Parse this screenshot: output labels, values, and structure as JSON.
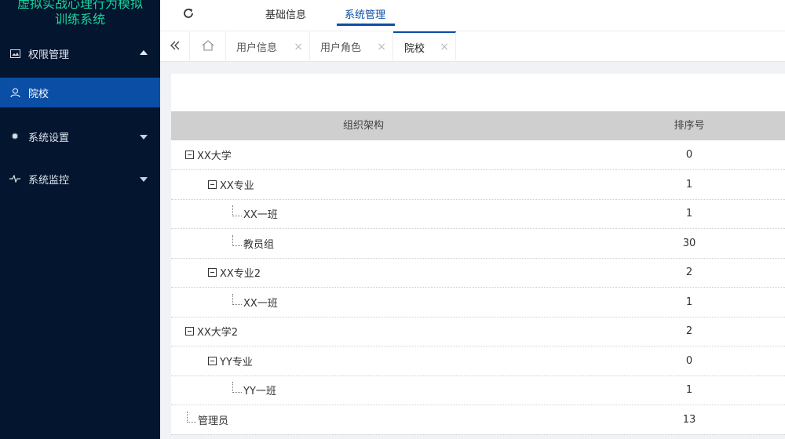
{
  "app": {
    "title_line1": "虚拟实战心理行为模拟",
    "title_line2": "训练系统"
  },
  "sidebar": {
    "items": [
      {
        "label": "权限管理",
        "icon": "image-icon",
        "expanded": true
      },
      {
        "label": "院校",
        "icon": "user-icon",
        "active": true
      },
      {
        "label": "系统设置",
        "icon": "gear-icon"
      },
      {
        "label": "系统监控",
        "icon": "pulse-icon"
      }
    ]
  },
  "topnav": {
    "tabs": [
      "基础信息",
      "系统管理"
    ],
    "active": "系统管理"
  },
  "tabs": {
    "items": [
      "用户信息",
      "用户角色",
      "院校"
    ],
    "active": "院校",
    "close_symbol": "×"
  },
  "table": {
    "columns": [
      "组织架构",
      "排序号"
    ],
    "rows": [
      {
        "name": "XX大学",
        "order": "0"
      },
      {
        "name": "XX专业",
        "order": "1"
      },
      {
        "name": "XX一班",
        "order": "1"
      },
      {
        "name": "教员组",
        "order": "30"
      },
      {
        "name": "XX专业2",
        "order": "2"
      },
      {
        "name": "XX一班",
        "order": "1"
      },
      {
        "name": "XX大学2",
        "order": "2"
      },
      {
        "name": "YY专业",
        "order": "0"
      },
      {
        "name": "YY一班",
        "order": "1"
      },
      {
        "name": "管理员",
        "order": "13"
      }
    ]
  },
  "colors": {
    "sidebar_bg": "#03152f",
    "accent": "#0b4ea6",
    "title_green": "#18d59a",
    "header_gray": "#cfcfcf"
  }
}
